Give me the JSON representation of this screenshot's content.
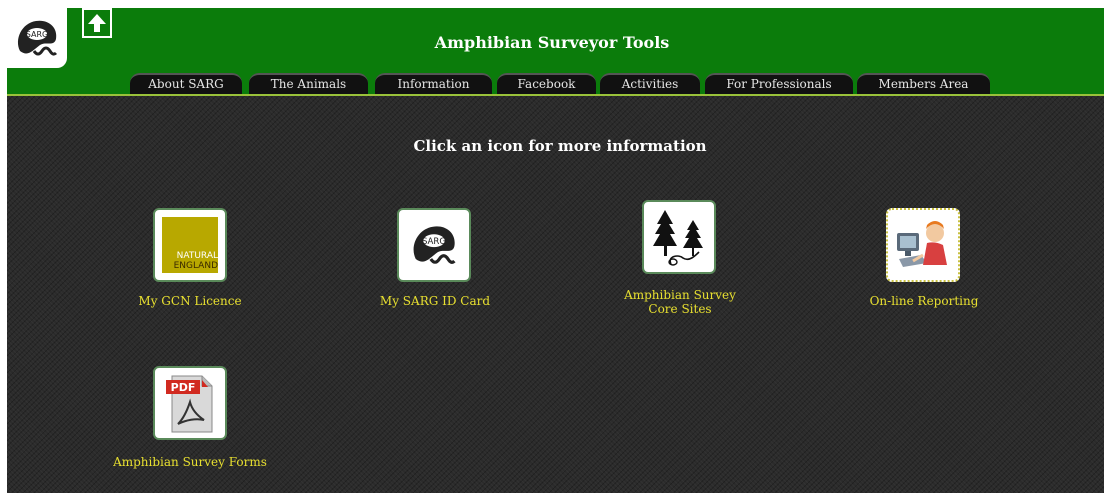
{
  "header": {
    "title": "Amphibian Surveyor Tools",
    "logo_text": "SARG",
    "up_icon": "up-arrow-icon",
    "bg_color": "#0b7c0b"
  },
  "nav": {
    "tabs": [
      {
        "label": "About SARG"
      },
      {
        "label": "The Animals"
      },
      {
        "label": "Information"
      },
      {
        "label": "Facebook"
      },
      {
        "label": "Activities"
      },
      {
        "label": "For Professionals"
      },
      {
        "label": "Members Area"
      }
    ]
  },
  "main": {
    "prompt": "Click an icon for more information",
    "items": [
      {
        "label": "My GCN Licence",
        "icon": "natural-england-logo-icon",
        "icon_text": [
          "NATURAL",
          "ENGLAND"
        ]
      },
      {
        "label": "My SARG ID Card",
        "icon": "sarg-logo-icon",
        "icon_text": "SARG"
      },
      {
        "label_lines": [
          "Amphibian Survey",
          "Core Sites"
        ],
        "icon": "trees-newt-icon"
      },
      {
        "label": "On-line Reporting",
        "icon": "person-at-computer-icon"
      },
      {
        "label": "Amphibian Survey Forms",
        "icon": "pdf-document-icon",
        "icon_text": "PDF"
      }
    ],
    "label_color": "#e8e030"
  }
}
